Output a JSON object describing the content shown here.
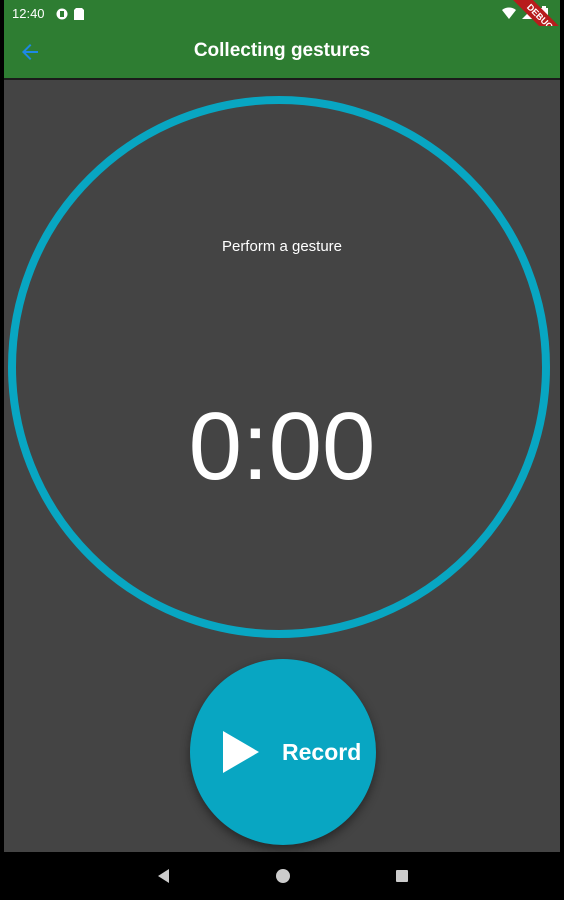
{
  "status_bar": {
    "time": "12:40",
    "icons_left": [
      "cast-icon",
      "sim-card-icon"
    ],
    "icons_right": [
      "wifi-icon",
      "signal-icon",
      "battery-icon"
    ],
    "debug_banner": "DEBUG"
  },
  "app_bar": {
    "title": "Collecting gestures",
    "back_icon": "arrow-back-icon",
    "color": "#2e7d32"
  },
  "timer": {
    "prompt": "Perform a gesture",
    "time_display": "0:00",
    "ring_color": "#08a6c2"
  },
  "record_button": {
    "label": "Record",
    "icon": "play-icon",
    "color": "#08a6c2"
  },
  "nav_bar": {
    "buttons": [
      "back-triangle-icon",
      "home-circle-icon",
      "recents-square-icon"
    ]
  }
}
